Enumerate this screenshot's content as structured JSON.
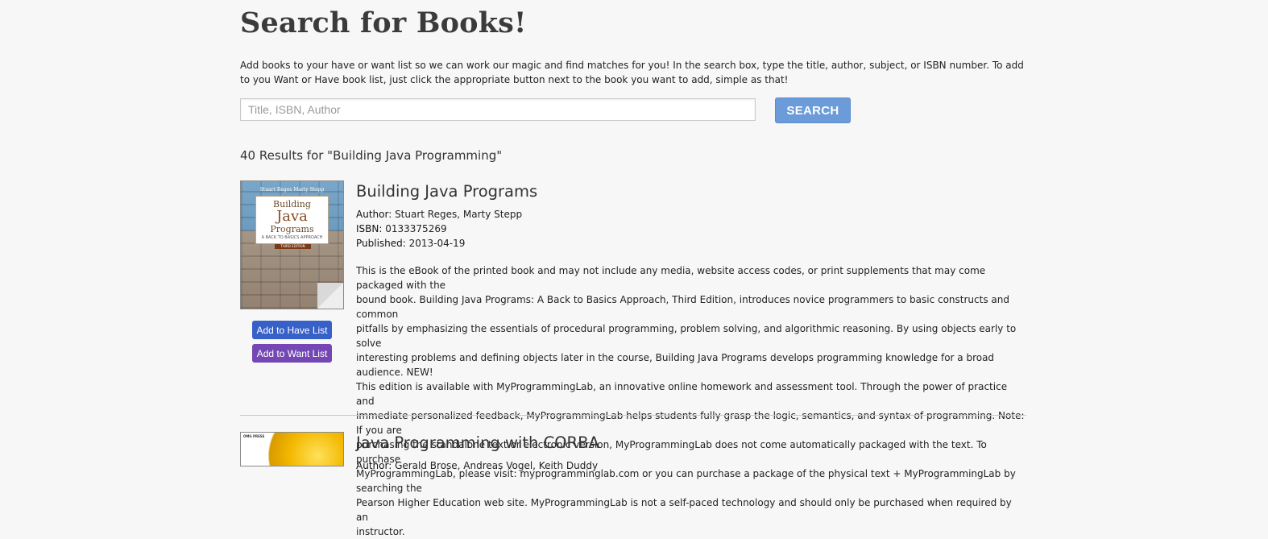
{
  "page": {
    "title": "Search for Books!",
    "intro": "Add books to your have or want list so we can work our magic and find matches for you! In the search box, type the title, author, subject, or ISBN number. To add to you Want or Have book list, just click the appropriate button next to the book you want to add, simple as that!"
  },
  "search": {
    "placeholder": "Title, ISBN, Author",
    "value": "",
    "button_label": "SEARCH"
  },
  "results": {
    "count_text": "40 Results for \"Building Java Programming\"",
    "books": [
      {
        "title": "Building Java Programs",
        "author_label": "Author:",
        "author": "Stuart Reges, Marty Stepp",
        "isbn_label": "ISBN:",
        "isbn": "0133375269",
        "published_label": "Published:",
        "published": "2013-04-19",
        "description": "This is the eBook of the printed book and may not include any media, website access codes, or print supplements that may come packaged with the\nbound book. Building Java Programs: A Back to Basics Approach, Third Edition, introduces novice programmers to basic constructs and common\npitfalls by emphasizing the essentials of procedural programming, problem solving, and algorithmic reasoning. By using objects early to solve\ninteresting problems and defining objects later in the course, Building Java Programs develops programming knowledge for a broad audience. NEW!\nThis edition is available with MyProgrammingLab, an innovative online homework and assessment tool. Through the power of practice and\nimmediate personalized feedback, MyProgrammingLab helps students fully grasp the logic, semantics, and syntax of programming. Note: If you are\npurchasing the standalone text or electronic version, MyProgrammingLab does not come automatically packaged with the text. To purchase\nMyProgrammingLab, please visit: myprogramminglab.com or you can purchase a package of the physical text + MyProgrammingLab by searching the\nPearson Higher Education web site. MyProgrammingLab is not a self-paced technology and should only be purchased when required by an\ninstructor.",
        "cover": {
          "authors": "Stuart Reges        Marty Stepp",
          "line1": "Building",
          "line2": "Java",
          "line3": "Programs",
          "subtitle": "A BACK TO BASICS APPROACH",
          "edition": "THIRD EDITION"
        },
        "have_button": "Add to Have List",
        "want_button": "Add to Want List"
      },
      {
        "title": "Java Programming with CORBA",
        "author_label": "Author:",
        "author": "Gerald Brose, Andreas Vogel, Keith Duddy",
        "cover": {
          "publisher": "OMG PRESS"
        }
      }
    ]
  },
  "colors": {
    "background": "#f7f7f7",
    "search_button": "#6b9bd9",
    "have_button": "#3760c9",
    "want_button": "#7447b4",
    "divider": "#c6c6ea"
  }
}
